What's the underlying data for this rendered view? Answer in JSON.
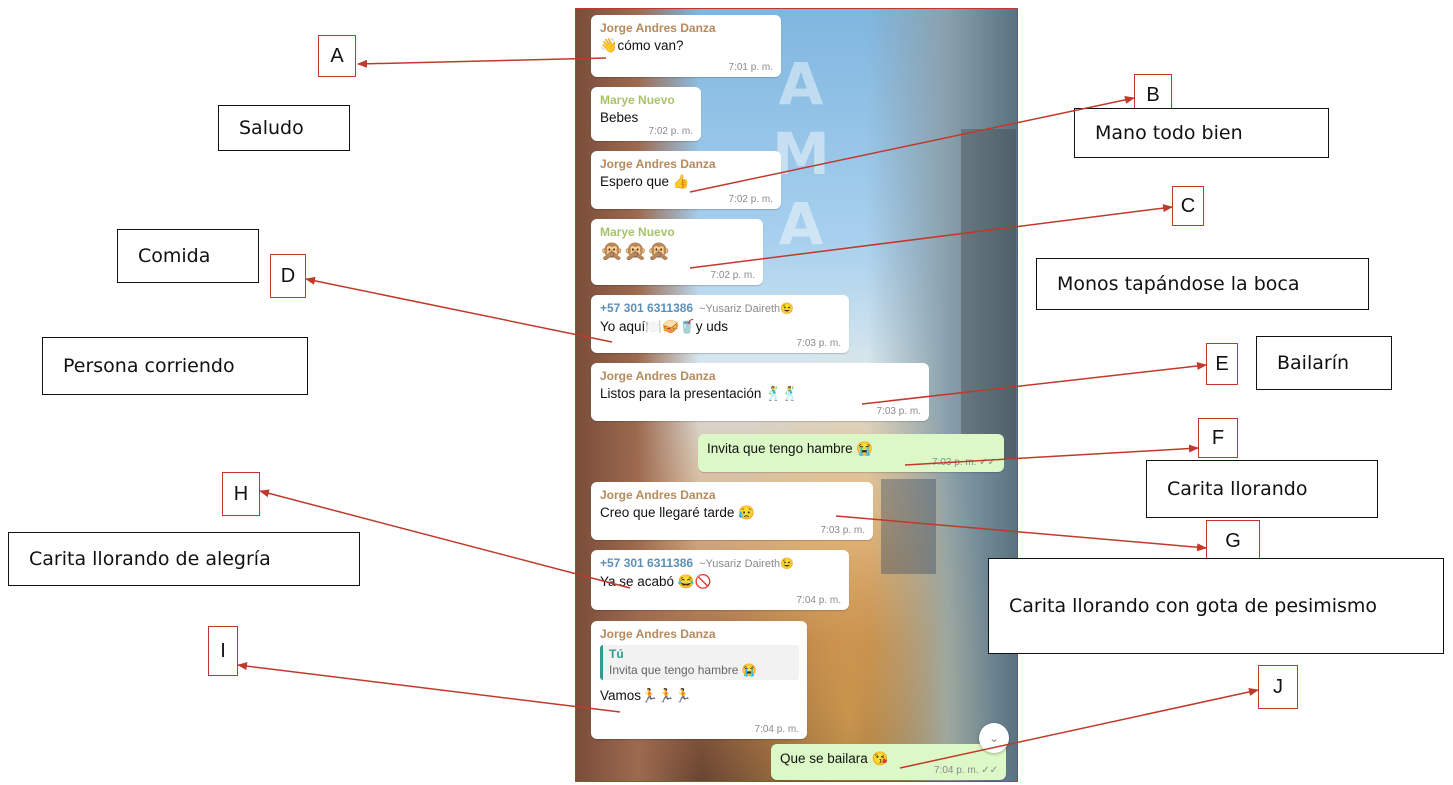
{
  "chat": {
    "messages": [
      {
        "sender": "Jorge Andres Danza",
        "text": "cómo van?",
        "emoji_before": "👋",
        "time": "7:01 p. m."
      },
      {
        "sender": "Marye Nuevo",
        "text": "Bebes",
        "time": "7:02 p. m."
      },
      {
        "sender": "Jorge Andres Danza",
        "text": "Espero que 👍",
        "time": "7:02 p. m."
      },
      {
        "sender": "Marye Nuevo",
        "text": "🙊🙊🙊",
        "time": "7:02 p. m."
      },
      {
        "sender": "+57 301 6311386",
        "alias": "~Yusariz Daireth😉",
        "text": "Yo aquí🍽️🥪🥤y uds",
        "time": "7:03 p. m."
      },
      {
        "sender": "Jorge Andres Danza",
        "text": "Listos para  la presentación 🕺🕺",
        "time": "7:03 p. m."
      },
      {
        "text": "Invita que tengo hambre 😭",
        "time": "7:03 p. m. ✓✓"
      },
      {
        "sender": "Jorge Andres Danza",
        "text": "Creo que  llegaré tarde 😥",
        "time": "7:03 p. m."
      },
      {
        "sender": "+57 301 6311386",
        "alias": "~Yusariz Daireth😉",
        "text": "Ya se acabó 😂🚫",
        "time": "7:04 p. m."
      },
      {
        "sender": "Jorge Andres Danza",
        "quote_author": "Tú",
        "quote_text": "Invita que tengo hambre 😭",
        "text": "Vamos🏃🏃🏃",
        "time": "7:04 p. m."
      },
      {
        "text": "Que se bailara 😘",
        "time": "7:04 p. m. ✓✓"
      }
    ],
    "scroll_icon": "double-chevron-down-icon",
    "colors": {
      "incoming": "#ffffff",
      "outgoing": "#dcf8c6",
      "sender_jorge": "#b58a5c",
      "sender_marye": "#a8c26a",
      "sender_phone": "#5b8fb8"
    }
  },
  "annotations": {
    "letters": [
      "A",
      "B",
      "C",
      "D",
      "E",
      "F",
      "G",
      "H",
      "I",
      "J"
    ],
    "labels": {
      "saludo": "Saludo",
      "mano": "Mano todo bien",
      "comida": "Comida",
      "monos": "Monos tapándose la boca",
      "corriendo": "Persona corriendo",
      "bailarin": "Bailarín",
      "llorando": "Carita llorando",
      "alegria": "Carita llorando de alegría",
      "pesimismo": "Carita llorando con gota de pesimismo"
    },
    "arrow_color": "#c0392b"
  }
}
